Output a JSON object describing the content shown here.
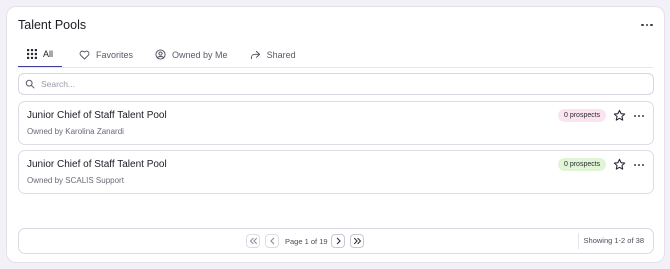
{
  "header": {
    "title": "Talent Pools",
    "more_icon": "ellipsis-icon"
  },
  "tabs": [
    {
      "label": "All",
      "icon": "grid-icon",
      "active": true
    },
    {
      "label": "Favorites",
      "icon": "heart-icon",
      "active": false
    },
    {
      "label": "Owned by Me",
      "icon": "user-circle-icon",
      "active": false
    },
    {
      "label": "Shared",
      "icon": "share-icon",
      "active": false
    }
  ],
  "search": {
    "placeholder": "Search...",
    "value": "",
    "icon": "search-icon"
  },
  "pools": [
    {
      "name": "Junior Chief of Staff Talent Pool",
      "owner": "Owned by Karolina Zanardi",
      "prospects": "0 prospects",
      "badge_color": "#fbe4ee"
    },
    {
      "name": "Junior Chief of Staff Talent Pool",
      "owner": "Owned by SCALIS Support",
      "prospects": "0 prospects",
      "badge_color": "#dff5d6"
    }
  ],
  "pagination": {
    "page_label": "Page 1 of 19",
    "showing": "Showing 1-2 of 38"
  },
  "colors": {
    "accent": "#3b3f9e",
    "border": "#dedce6"
  }
}
